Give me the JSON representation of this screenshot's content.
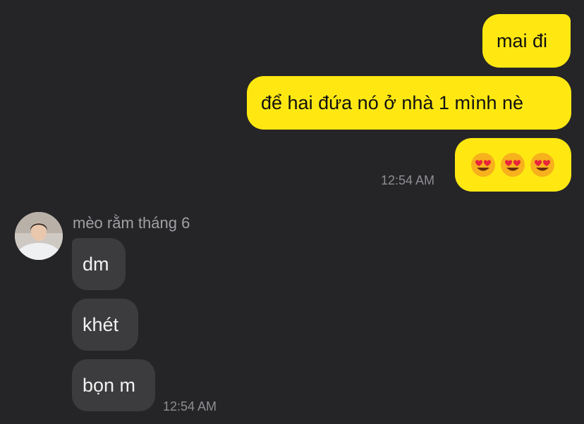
{
  "outgoing": [
    {
      "text": "mai đi"
    },
    {
      "text": "để hai đứa nó ở nhà 1 mình nè"
    },
    {
      "emojis": [
        "heart-eyes-emoji",
        "heart-eyes-emoji",
        "heart-eyes-emoji"
      ]
    }
  ],
  "outgoing_time": "12:54 AM",
  "incoming_sender": "mèo rằm tháng 6",
  "incoming": [
    {
      "text": "dm"
    },
    {
      "text": "khét"
    },
    {
      "text": "bọn m"
    }
  ],
  "incoming_time": "12:54 AM",
  "colors": {
    "background": "#252527",
    "outgoing_bubble": "#ffe812",
    "incoming_bubble": "#3c3c3e",
    "timestamp": "#8e8e93"
  }
}
